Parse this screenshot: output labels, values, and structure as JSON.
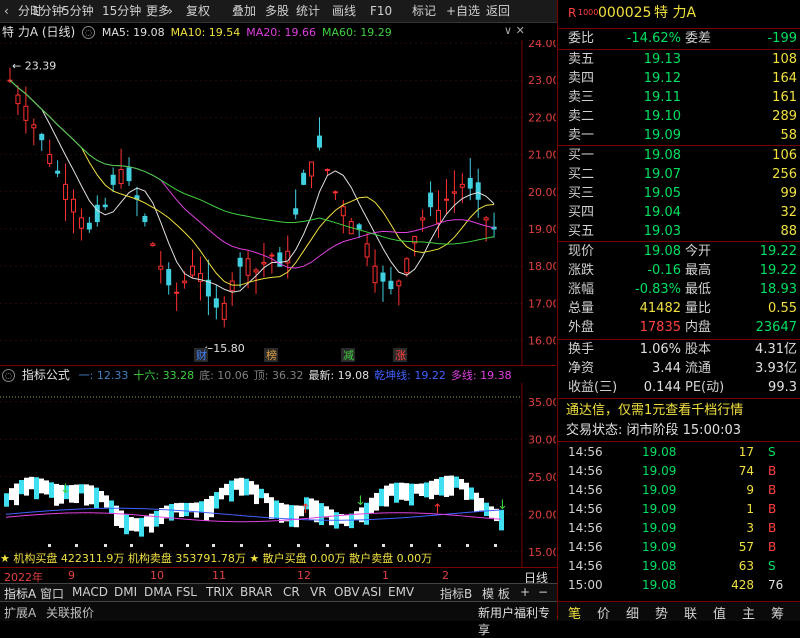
{
  "toolbar": {
    "items": [
      "分时",
      "1分钟",
      "5分钟",
      "15分钟",
      "更多",
      "复权",
      "叠加",
      "多股",
      "统计",
      "画线",
      "F10",
      "标记",
      "+自选",
      "返回"
    ]
  },
  "chart": {
    "title": "特 力A (日线)",
    "ma": [
      {
        "label": "MA5: 19.08",
        "color": "#e0e0e0"
      },
      {
        "label": "MA10: 19.54",
        "color": "#f0e040"
      },
      {
        "label": "MA20: 19.66",
        "color": "#e040e0"
      },
      {
        "label": "MA60: 19.29",
        "color": "#40d040"
      }
    ],
    "y_labels": [
      "24.00",
      "23.00",
      "22.00",
      "21.00",
      "20.00",
      "19.00",
      "18.00",
      "17.00",
      "16.00"
    ],
    "high_marker": "23.39",
    "low_marker": "15.80",
    "event_labels": [
      {
        "text": "财",
        "color": "#4080ff"
      },
      {
        "text": "榜",
        "color": "#e0a040"
      },
      {
        "text": "减",
        "color": "#40d040"
      },
      {
        "text": "涨",
        "color": "#ff4040"
      }
    ]
  },
  "indicator": {
    "name": "指标公式",
    "items": [
      {
        "label": "一: 12.33",
        "color": "#4080c0"
      },
      {
        "label": "十六: 33.28",
        "color": "#40d040"
      },
      {
        "label": "底: 10.06",
        "color": "#808080"
      },
      {
        "label": "顶: 36.32",
        "color": "#808080"
      },
      {
        "label": "最新: 19.08",
        "color": "#e0e0e0"
      },
      {
        "label": "乾坤线: 19.22",
        "color": "#4060ff"
      },
      {
        "label": "多线: 19.38",
        "color": "#e040e0"
      }
    ],
    "y_labels": [
      "35.00",
      "30.00",
      "25.00",
      "20.00",
      "15.00"
    ],
    "footer": "★ 机构买盘 422311.9万  机构卖盘 353791.78万 ★ 散户买盘 0.00万    散户卖盘 0.00万"
  },
  "time_axis": {
    "year": "2022年",
    "months": [
      "9",
      "10",
      "11",
      "12",
      "1",
      "2"
    ],
    "right_label": "日线"
  },
  "tabs": [
    "指标A",
    "窗口",
    "MACD",
    "DMI",
    "DMA",
    "FSL",
    "TRIX",
    "BRAR",
    "CR",
    "VR",
    "OBV",
    "ASI",
    "EMV",
    "指标B",
    "模 板",
    "+",
    "−"
  ],
  "bottom_left": [
    "扩展A",
    "关联报价"
  ],
  "bottom_promo": "新用户福利专享",
  "quote": {
    "code": "000025",
    "name": "特 力A",
    "tag": "R",
    "tag_sub": "1000",
    "weibi_label": "委比",
    "weibi": "-14.62%",
    "weicha_label": "委差",
    "weicha": "-199",
    "asks": [
      {
        "label": "卖五",
        "price": "19.13",
        "vol": "108"
      },
      {
        "label": "卖四",
        "price": "19.12",
        "vol": "164"
      },
      {
        "label": "卖三",
        "price": "19.11",
        "vol": "161"
      },
      {
        "label": "卖二",
        "price": "19.10",
        "vol": "289"
      },
      {
        "label": "卖一",
        "price": "19.09",
        "vol": "58"
      }
    ],
    "bids": [
      {
        "label": "买一",
        "price": "19.08",
        "vol": "106"
      },
      {
        "label": "买二",
        "price": "19.07",
        "vol": "256"
      },
      {
        "label": "买三",
        "price": "19.05",
        "vol": "99"
      },
      {
        "label": "买四",
        "price": "19.04",
        "vol": "32"
      },
      {
        "label": "买五",
        "price": "19.03",
        "vol": "88"
      }
    ],
    "stats": [
      {
        "l1": "现价",
        "v1": "19.08",
        "c1": "g",
        "l2": "今开",
        "v2": "19.22",
        "c2": "g"
      },
      {
        "l1": "涨跌",
        "v1": "-0.16",
        "c1": "g",
        "l2": "最高",
        "v2": "19.22",
        "c2": "g"
      },
      {
        "l1": "涨幅",
        "v1": "-0.83%",
        "c1": "g",
        "l2": "最低",
        "v2": "18.93",
        "c2": "g"
      },
      {
        "l1": "总量",
        "v1": "41482",
        "c1": "y",
        "l2": "量比",
        "v2": "0.55",
        "c2": "y"
      },
      {
        "l1": "外盘",
        "v1": "17835",
        "c1": "r",
        "l2": "内盘",
        "v2": "23647",
        "c2": "g"
      }
    ],
    "stats2": [
      {
        "l1": "换手",
        "v1": "1.06%",
        "l2": "股本",
        "v2": "4.31亿"
      },
      {
        "l1": "净资",
        "v1": "3.44",
        "l2": "流通",
        "v2": "3.93亿"
      },
      {
        "l1": "收益(三)",
        "v1": "0.144",
        "l2": "PE(动)",
        "v2": "99.3"
      }
    ],
    "promo": "通达信，仅需1元查看千档行情",
    "status": "交易状态: 闭市阶段 15:00:03",
    "ticks": [
      {
        "t": "14:56",
        "p": "19.08",
        "v": "17",
        "s": "S"
      },
      {
        "t": "14:56",
        "p": "19.09",
        "v": "74",
        "s": "B"
      },
      {
        "t": "14:56",
        "p": "19.09",
        "v": "9",
        "s": "B"
      },
      {
        "t": "14:56",
        "p": "19.09",
        "v": "1",
        "s": "B"
      },
      {
        "t": "14:56",
        "p": "19.09",
        "v": "3",
        "s": "B"
      },
      {
        "t": "14:56",
        "p": "19.09",
        "v": "57",
        "s": "B"
      },
      {
        "t": "14:56",
        "p": "19.08",
        "v": "63",
        "s": "S"
      },
      {
        "t": "15:00",
        "p": "19.08",
        "v": "428",
        "s": "76"
      }
    ],
    "bottom_tabs": [
      "笔",
      "价",
      "细",
      "势",
      "联",
      "值",
      "主",
      "筹"
    ]
  }
}
